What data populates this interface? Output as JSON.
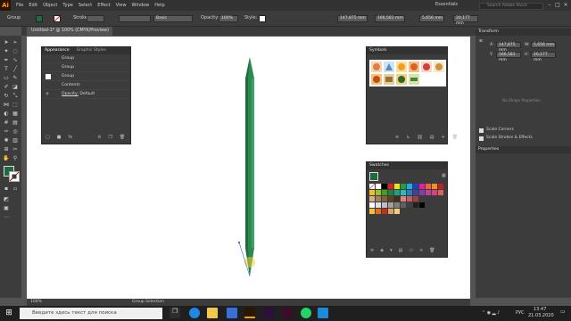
{
  "menubar": {
    "logo": "Ai",
    "items": [
      "File",
      "Edit",
      "Object",
      "Type",
      "Select",
      "Effect",
      "View",
      "Window",
      "Help"
    ],
    "workspace": "Essentials",
    "search_placeholder": "Search Adobe Stock"
  },
  "controlbar": {
    "selection": "Group",
    "stroke_label": "Stroke:",
    "basic_label": "Basic",
    "opacity_label": "Opacity:",
    "opacity_value": "100%",
    "style_label": "Style:",
    "x_value": "147,875 mm",
    "y_value": "166,581 mm",
    "w_value": "5,656 mm",
    "h_value": "20,177 mm"
  },
  "document": {
    "tab_title": "Untitled-1* @ 100% (CMYK/Preview)"
  },
  "appearance": {
    "tabs": [
      "Appearance",
      "Graphic Styles"
    ],
    "rows": [
      {
        "label": "Group"
      },
      {
        "label": "Group"
      },
      {
        "label": "Group"
      },
      {
        "label": "Contents"
      }
    ],
    "opacity_label": "Opacity:",
    "opacity_value": "Default"
  },
  "symbols": {
    "title": "Symbols"
  },
  "swatches": {
    "title": "Swatches"
  },
  "transform": {
    "title": "Transform",
    "x_label": "X:",
    "x_value": "147,875 mm",
    "y_label": "Y:",
    "y_value": "166,581 mm",
    "w_label": "W:",
    "w_value": "5,656 mm",
    "h_label": "H:",
    "h_value": "20,177 mm",
    "no_shape": "No Shape Properties",
    "scale_corners": "Scale Corners",
    "scale_strokes": "Scale Strokes & Effects"
  },
  "properties": {
    "title": "Properties"
  },
  "statusbar": {
    "zoom": "100%",
    "tool": "Group Selection"
  },
  "taskbar": {
    "search": "Введите здесь текст для поиска",
    "lang": "РУС",
    "time": "13:47",
    "date": "21.03.2020"
  },
  "colors": {
    "pencil_dark": "#1e6b3c",
    "pencil_mid": "#2a8a4f",
    "pencil_light": "#3aa463"
  }
}
